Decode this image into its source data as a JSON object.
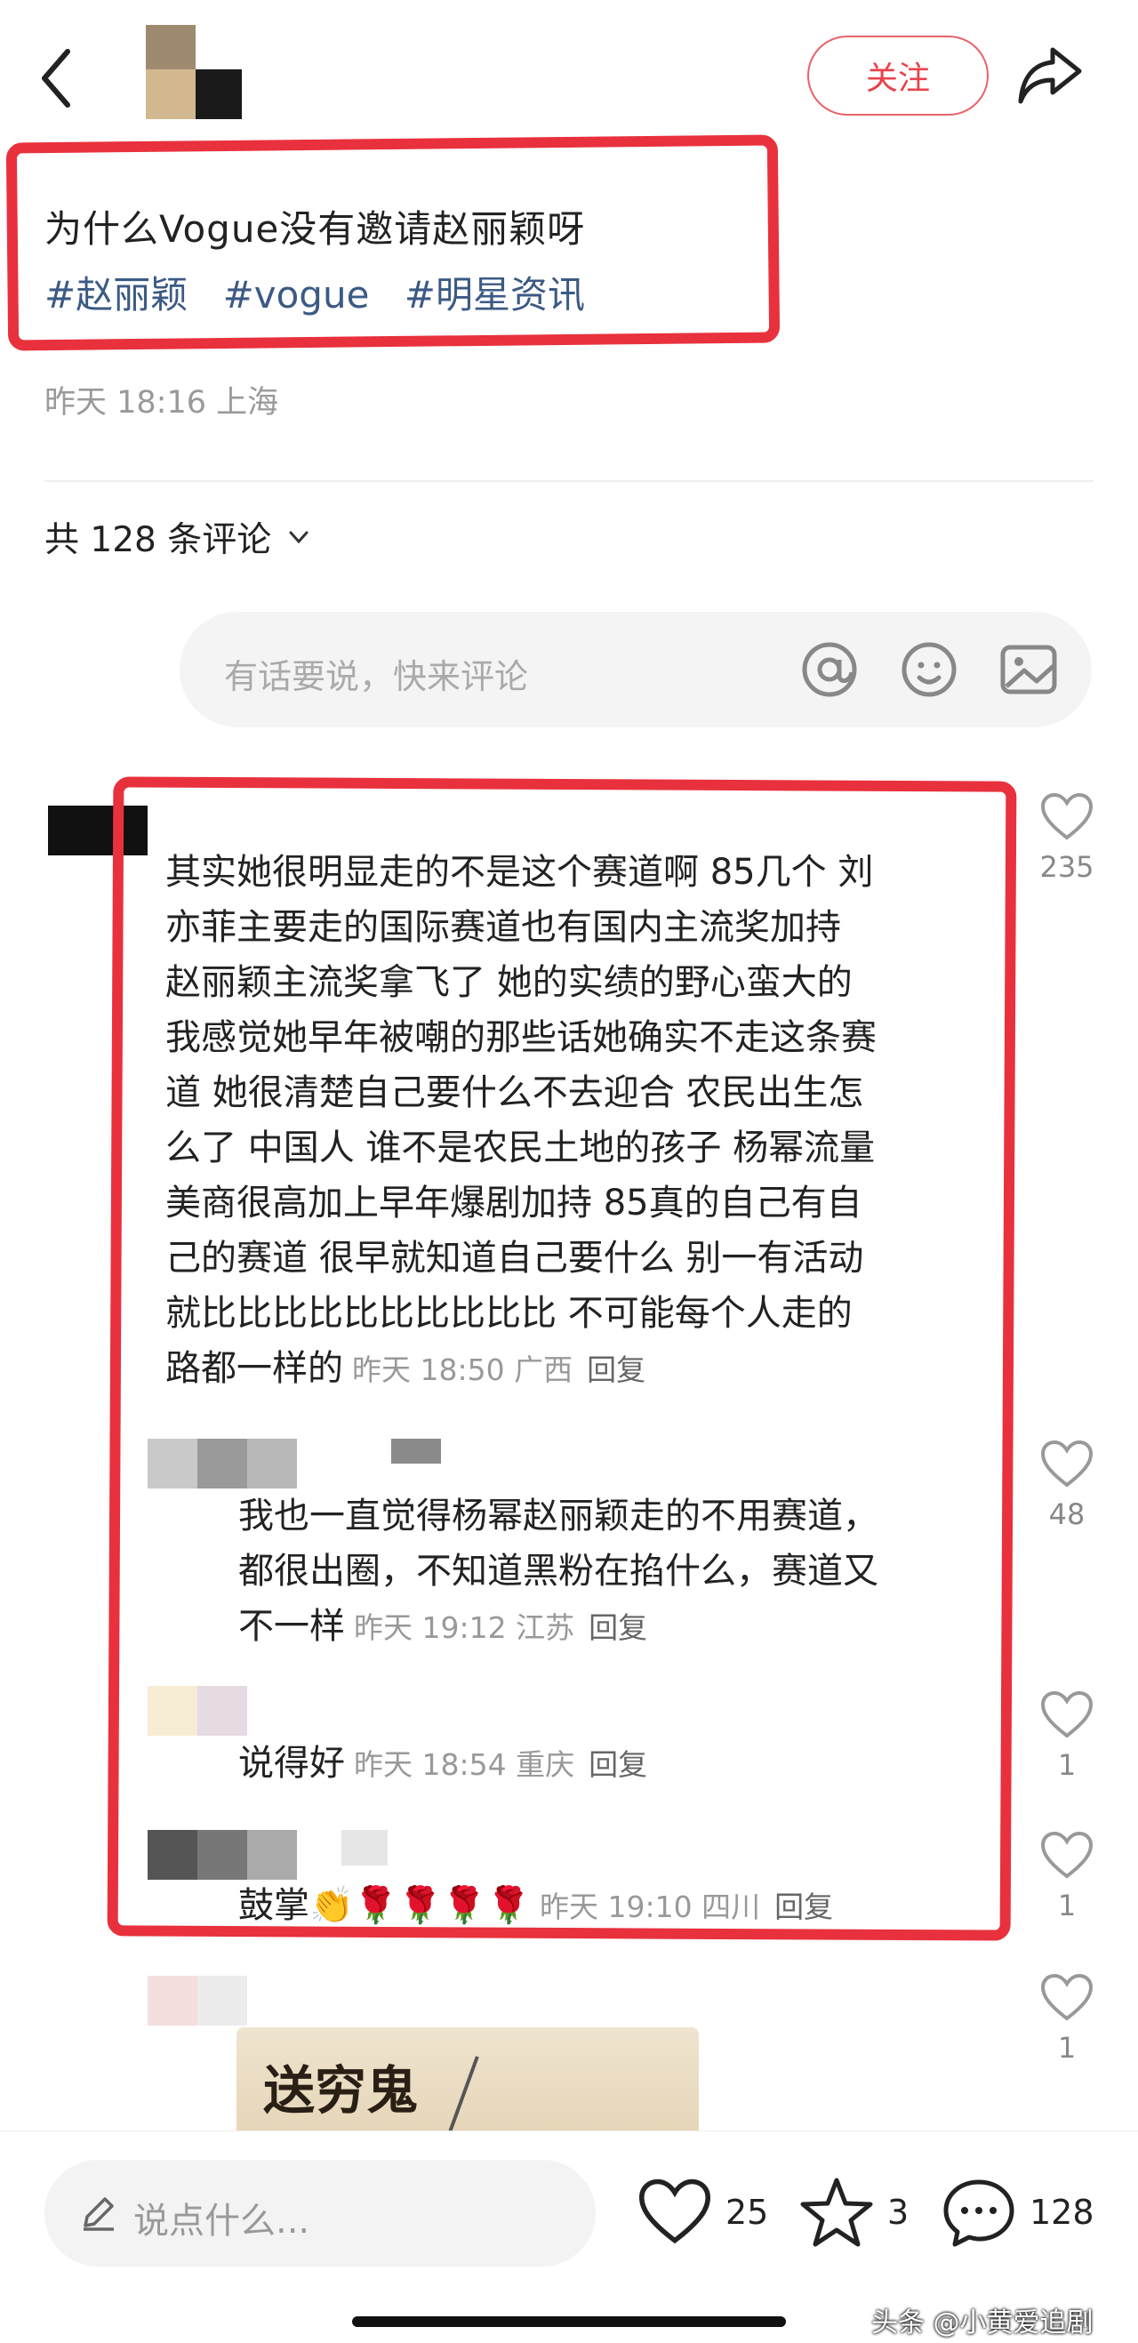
{
  "header": {
    "follow_label": "关注"
  },
  "post": {
    "title": "为什么Vogue没有邀请赵丽颖呀",
    "tags": [
      "#赵丽颖",
      "#vogue",
      "#明星资讯"
    ],
    "meta": "昨天 18:16 上海"
  },
  "comments_header": {
    "count_label": "共 128 条评论"
  },
  "comment_input": {
    "placeholder": "有话要说，快来评论"
  },
  "comments": [
    {
      "lines": [
        "其实她很明显走的不是这个赛道啊 85几个 刘",
        "亦菲主要走的国际赛道也有国内主流奖加持",
        "赵丽颖主流奖拿飞了 她的实绩的野心蛮大的",
        "我感觉她早年被嘲的那些话她确实不走这条赛",
        "道 她很清楚自己要什么不去迎合 农民出生怎",
        "么了 中国人 谁不是农民土地的孩子 杨幂流量",
        "美商很高加上早年爆剧加持 85真的自己有自",
        "己的赛道 很早就知道自己要什么 别一有活动",
        "就比比比比比比比比比比 不可能每个人走的",
        "路都一样的"
      ],
      "meta": "昨天 18:50 广西",
      "reply": "回复",
      "likes": "235"
    },
    {
      "lines": [
        "我也一直觉得杨幂赵丽颖走的不用赛道，",
        "都很出圈，不知道黑粉在掐什么，赛道又",
        "不一样"
      ],
      "meta": "昨天 19:12 江苏",
      "reply": "回复",
      "likes": "48"
    },
    {
      "lines": [
        "说得好"
      ],
      "meta": "昨天 18:54 重庆",
      "reply": "回复",
      "likes": "1"
    },
    {
      "lines": [
        "鼓掌👏🌹🌹🌹🌹"
      ],
      "meta": "昨天 19:10 四川",
      "reply": "回复",
      "likes": "1"
    },
    {
      "lines": [],
      "image_text": "送穷鬼",
      "likes": "1"
    }
  ],
  "bottom_bar": {
    "placeholder": "说点什么...",
    "likes": "25",
    "stars": "3",
    "comments": "128"
  },
  "watermark": "头条 @小黄爱追剧",
  "colors": {
    "accent": "#e8434c",
    "tag": "#3b5a84",
    "annotation": "#e8313d"
  }
}
